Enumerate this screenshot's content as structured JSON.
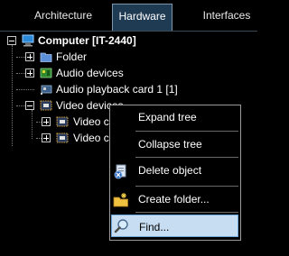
{
  "tabs": [
    {
      "label": "Architecture"
    },
    {
      "label": "Hardware",
      "active": true
    },
    {
      "label": "Interfaces"
    }
  ],
  "tree": {
    "root": {
      "label": "Computer [IT-2440]",
      "expanded": true,
      "icon": "computer-icon"
    },
    "items": [
      {
        "label": "Folder",
        "icon": "folder-icon",
        "expander": "plus"
      },
      {
        "label": "Audio devices",
        "icon": "audio-board-icon",
        "expander": "plus"
      },
      {
        "label": "Audio playback card 1 [1]",
        "icon": "audio-card-icon",
        "expander": "none"
      },
      {
        "label": "Video devices",
        "icon": "video-board-icon",
        "expander": "minus"
      },
      {
        "label": "Video ca",
        "icon": "video-capture-icon",
        "expander": "plus"
      },
      {
        "label": "Video ca",
        "icon": "video-capture-icon",
        "expander": "plus"
      }
    ]
  },
  "context_menu": {
    "items": [
      {
        "label": "Expand tree"
      },
      {
        "label": "Collapse tree"
      },
      {
        "label": "Delete object",
        "icon": "delete-icon"
      },
      {
        "label": "Create folder...",
        "icon": "new-folder-icon"
      },
      {
        "label": "Find...",
        "icon": "find-icon",
        "highlighted": true
      }
    ]
  },
  "colors": {
    "background": "#000000",
    "active_tab": "#1f3b54",
    "highlight": "#c7ddf1",
    "highlight_border": "#6ea8da"
  }
}
